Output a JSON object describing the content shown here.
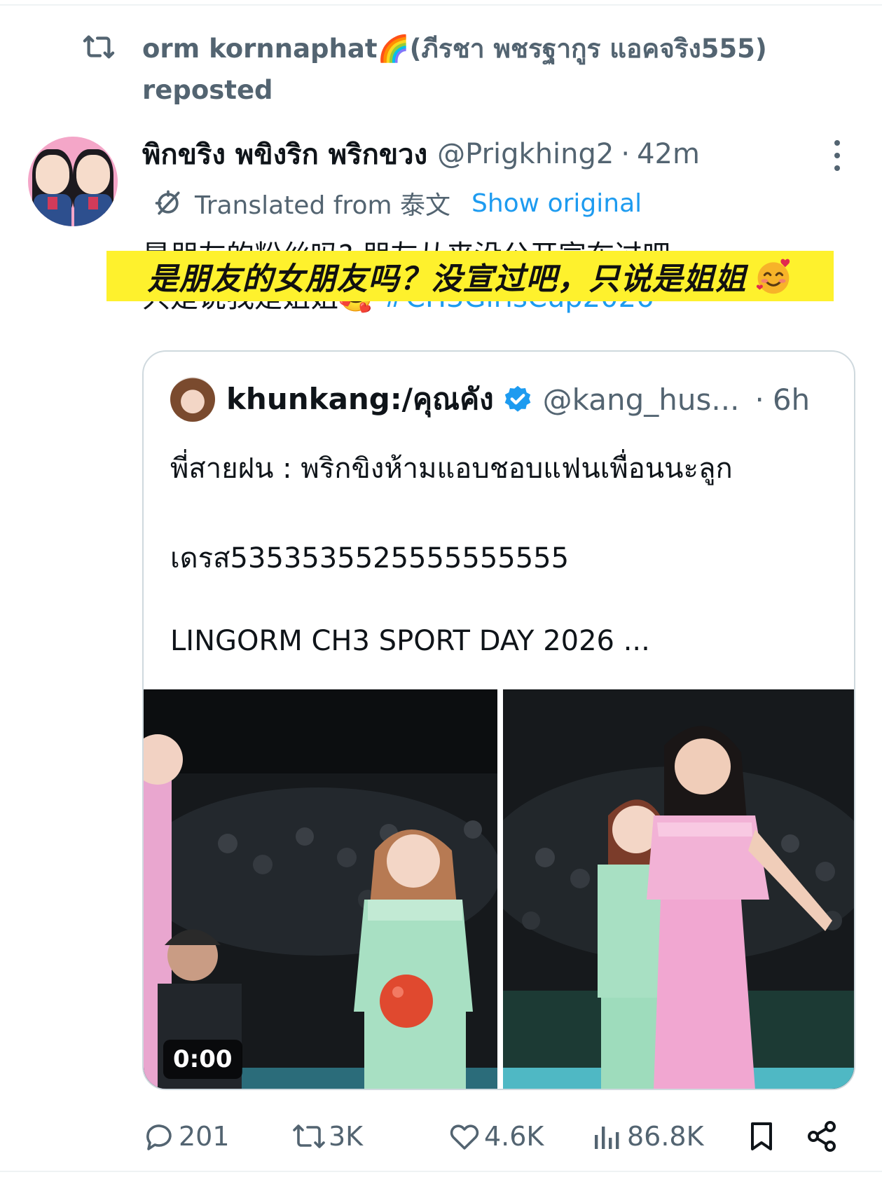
{
  "repost": {
    "icon": "repost-icon",
    "text": "orm kornnaphat🌈(ภีรชา พชรฐากูร แอคจริง555) reposted"
  },
  "tweet": {
    "author_name": "พิกขริง พขิงริก พริกขวง",
    "handle": "@Prigkhing2",
    "separator": "·",
    "time": "42m",
    "translated_label": "Translated from 泰文",
    "show_original": "Show original",
    "text_line1": "是朋友的粉丝吗? 朋友从来没公开宣布过吧",
    "text_line2": "只是说我是姐姐🥰 ",
    "hashtag": "#CH3GirlsCup2026"
  },
  "caption": {
    "text": "是朋友的女朋友吗？没宣过吧，只说是姐姐",
    "emoji": "smiling-face-with-hearts-icon"
  },
  "quote": {
    "name": "khunkang:/คุณคัง",
    "verified_icon": "verified-badge-icon",
    "handle": "@kang_hus...",
    "separator": "·",
    "time": "6h",
    "line1": "พี่สายฝน : พริกขิงห้ามแอบชอบแฟนเพื่อนนะลูก",
    "line2": "เดรส5353535525555555555",
    "line3": "LINGORM CH3 SPORT DAY 2026 ...",
    "video_duration": "0:00"
  },
  "actions": {
    "replies": "201",
    "reposts": "3K",
    "likes": "4.6K",
    "views": "86.8K"
  },
  "colors": {
    "link": "#1d9bf0",
    "secondary_text": "#536471",
    "caption_bg": "#fef12d",
    "border": "#cfd9de"
  }
}
